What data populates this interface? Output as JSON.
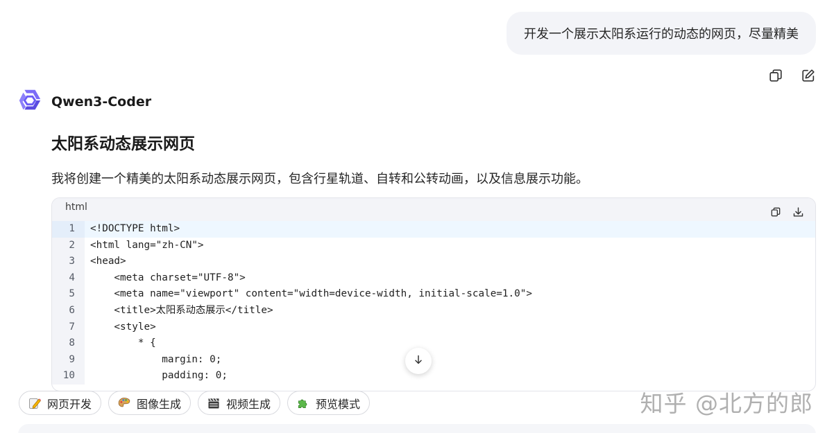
{
  "user_message": {
    "text": "开发一个展示太阳系运行的动态的网页，尽量精美"
  },
  "message_actions": {
    "copy_icon": "copy-icon",
    "edit_icon": "edit-icon"
  },
  "assistant": {
    "name": "Qwen3-Coder",
    "logo_icon": "qwen-logo-icon",
    "logo_color": "#6b5cf6"
  },
  "reply": {
    "title": "太阳系动态展示网页",
    "description": "我将创建一个精美的太阳系动态展示网页，包含行星轨道、自转和公转动画，以及信息展示功能。"
  },
  "code_block": {
    "language": "html",
    "copy_icon": "copy-icon",
    "download_icon": "download-icon",
    "lines": [
      {
        "num": "1",
        "text": "<!DOCTYPE html>"
      },
      {
        "num": "2",
        "text": "<html lang=\"zh-CN\">"
      },
      {
        "num": "3",
        "text": "<head>"
      },
      {
        "num": "4",
        "text": "    <meta charset=\"UTF-8\">"
      },
      {
        "num": "5",
        "text": "    <meta name=\"viewport\" content=\"width=device-width, initial-scale=1.0\">"
      },
      {
        "num": "6",
        "text": "    <title>太阳系动态展示</title>"
      },
      {
        "num": "7",
        "text": "    <style>"
      },
      {
        "num": "8",
        "text": "        * {"
      },
      {
        "num": "9",
        "text": "            margin: 0;"
      },
      {
        "num": "10",
        "text": "            padding: 0;"
      }
    ]
  },
  "scroll_down_icon": "arrow-down-icon",
  "chips": [
    {
      "label": "网页开发",
      "icon": "pencil-icon"
    },
    {
      "label": "图像生成",
      "icon": "palette-icon"
    },
    {
      "label": "视频生成",
      "icon": "clapperboard-icon"
    },
    {
      "label": "预览模式",
      "icon": "puzzle-icon"
    }
  ],
  "watermark": "知乎 @北方的郎"
}
